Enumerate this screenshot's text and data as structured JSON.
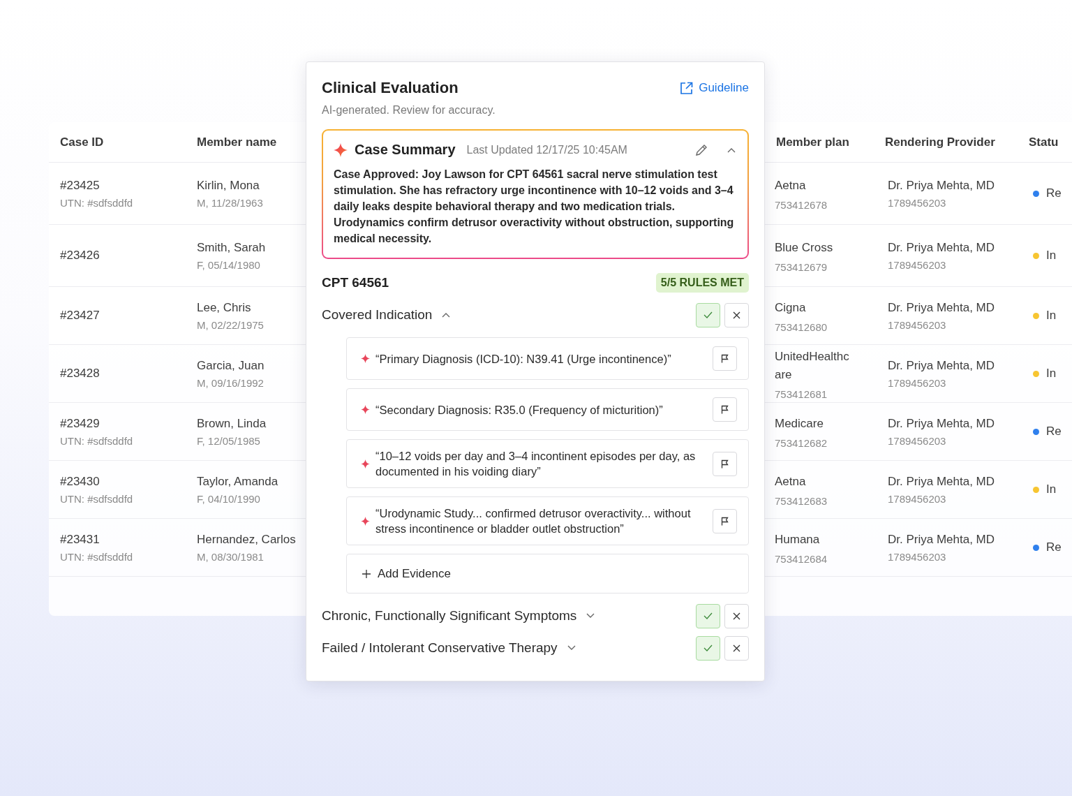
{
  "table": {
    "columns": [
      "Case ID",
      "Member name",
      "Member plan",
      "Rendering Provider",
      "Statu"
    ],
    "rows": [
      {
        "case_id": "#23425",
        "utn": "UTN: #sdfsddfd",
        "member": "Kirlin, Mona",
        "member_info": "M, 11/28/1963",
        "plan": "Aetna",
        "plan_id": "753412678",
        "provider": "Dr. Priya Mehta, MD",
        "provider_id": "1789456203",
        "status": "Re",
        "color": "#2f80ed"
      },
      {
        "case_id": "#23426",
        "member": "Smith, Sarah",
        "member_info": "F, 05/14/1980",
        "plan": "Blue Cross",
        "plan_id": "753412679",
        "provider": "Dr. Priya Mehta, MD",
        "provider_id": "1789456203",
        "status": "In",
        "color": "#f7c531"
      },
      {
        "case_id": "#23427",
        "member": "Lee, Chris",
        "member_info": "M, 02/22/1975",
        "plan": "Cigna",
        "plan_id": "753412680",
        "provider": "Dr. Priya Mehta, MD",
        "provider_id": "1789456203",
        "status": "In",
        "color": "#f7c531"
      },
      {
        "case_id": "#23428",
        "member": "Garcia, Juan",
        "member_info": "M, 09/16/1992",
        "plan": "UnitedHealthc are",
        "plan_id": "753412681",
        "provider": "Dr. Priya Mehta, MD",
        "provider_id": "1789456203",
        "status": "In",
        "color": "#f7c531"
      },
      {
        "case_id": "#23429",
        "utn": "UTN: #sdfsddfd",
        "member": "Brown, Linda",
        "member_info": "F, 12/05/1985",
        "plan": "Medicare",
        "plan_id": "753412682",
        "provider": "Dr. Priya Mehta, MD",
        "provider_id": "1789456203",
        "status": "Re",
        "color": "#2f80ed"
      },
      {
        "case_id": "#23430",
        "utn": "UTN: #sdfsddfd",
        "member": "Taylor, Amanda",
        "member_info": "F, 04/10/1990",
        "plan": "Aetna",
        "plan_id": "753412683",
        "provider": "Dr. Priya Mehta, MD",
        "provider_id": "1789456203",
        "status": "In",
        "color": "#f7c531"
      },
      {
        "case_id": "#23431",
        "utn": "UTN: #sdfsddfd",
        "member": "Hernandez, Carlos",
        "member_info": "M, 08/30/1981",
        "plan": "Humana",
        "plan_id": "753412684",
        "provider": "Dr. Priya Mehta, MD",
        "provider_id": "1789456203",
        "status": "Re",
        "color": "#2f80ed"
      }
    ]
  },
  "evaluation": {
    "title": "Clinical Evaluation",
    "link": "Guideline",
    "subtitle": "AI-generated. Review for accuracy.",
    "summary": {
      "title": "Case Summary",
      "updated": "Last Updated 12/17/25 10:45AM",
      "expanded": true,
      "text": "Case Approved: Joy Lawson for CPT 64561 sacral nerve stimulation test stimulation. She has refractory urge incontinence with 10–12 voids and 3–4 daily leaks despite behavioral therapy and two medication trials. Urodynamics confirm detrusor overactivity without obstruction, supporting medical necessity."
    },
    "code": "CPT 64561",
    "rules": "5/5 RULES MET",
    "criteria": [
      {
        "title": "Covered Indication",
        "expanded": true,
        "approved": true,
        "evidence": [
          "“Primary Diagnosis (ICD-10): N39.41 (Urge incontinence)”",
          "“Secondary Diagnosis: R35.0 (Frequency of micturition)”",
          "“10–12 voids per day and 3–4 incontinent episodes per day, as documented in his voiding diary”",
          "“Urodynamic Study... confirmed detrusor overactivity... without stress incontinence or bladder outlet obstruction”"
        ],
        "add": "Add Evidence"
      },
      {
        "title": "Chronic, Functionally Significant Symptoms",
        "expanded": false,
        "approved": true
      },
      {
        "title": "Failed / Intolerant Conservative Therapy",
        "expanded": false,
        "approved": true
      }
    ]
  }
}
